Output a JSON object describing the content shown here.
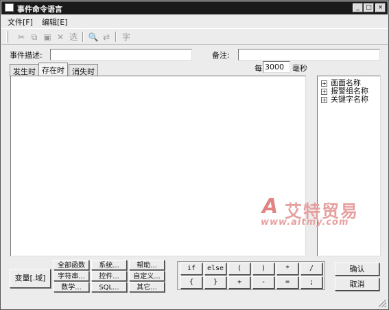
{
  "window": {
    "title": "事件命令语言",
    "controls": {
      "minimize": "_",
      "maximize": "□",
      "close": "×"
    }
  },
  "menu": [
    {
      "label": "文件[F]"
    },
    {
      "label": "编辑[E]"
    }
  ],
  "toolbar": {
    "icons": [
      "cut-icon",
      "copy-icon",
      "paste-icon",
      "delete-icon",
      "select-all-icon",
      "find-icon",
      "replace-icon",
      "font-icon"
    ],
    "glyphs": {
      "cut": "✂",
      "copy": "⧉",
      "paste": "▣",
      "delete": "✕",
      "select_all": "选",
      "find": "🔍",
      "replace": "⇄",
      "font": "字"
    }
  },
  "form": {
    "description_label": "事件描述:",
    "description_value": "",
    "note_label": "备注:",
    "note_value": ""
  },
  "tabs": [
    {
      "label": "发生时",
      "active": false
    },
    {
      "label": "存在时",
      "active": true
    },
    {
      "label": "消失时",
      "active": false
    }
  ],
  "interval": {
    "prefix": "每",
    "value": "3000",
    "unit": "毫秒"
  },
  "tree": {
    "items": [
      {
        "label": "画面名称",
        "expander": "+"
      },
      {
        "label": "报警组名称",
        "expander": "+"
      },
      {
        "label": "关键字名称",
        "expander": "+"
      }
    ]
  },
  "watermark": {
    "logo_letter": "A",
    "brand": "艾特贸易",
    "url": "www.aitmy.com"
  },
  "functions": {
    "variable": "变量[.域]",
    "all_functions": "全部函数",
    "string": "字符串...",
    "math": "数学...",
    "system": "系统...",
    "control": "控件...",
    "sql": "SQL...",
    "help": "帮助...",
    "custom": "自定义...",
    "other": "其它..."
  },
  "operators": {
    "row1": [
      "if",
      "else",
      "(",
      ")",
      "*",
      "/"
    ],
    "row2": [
      "{",
      "}",
      "+",
      "-",
      "=",
      ";"
    ]
  },
  "actions": {
    "ok": "确认",
    "cancel": "取消"
  }
}
